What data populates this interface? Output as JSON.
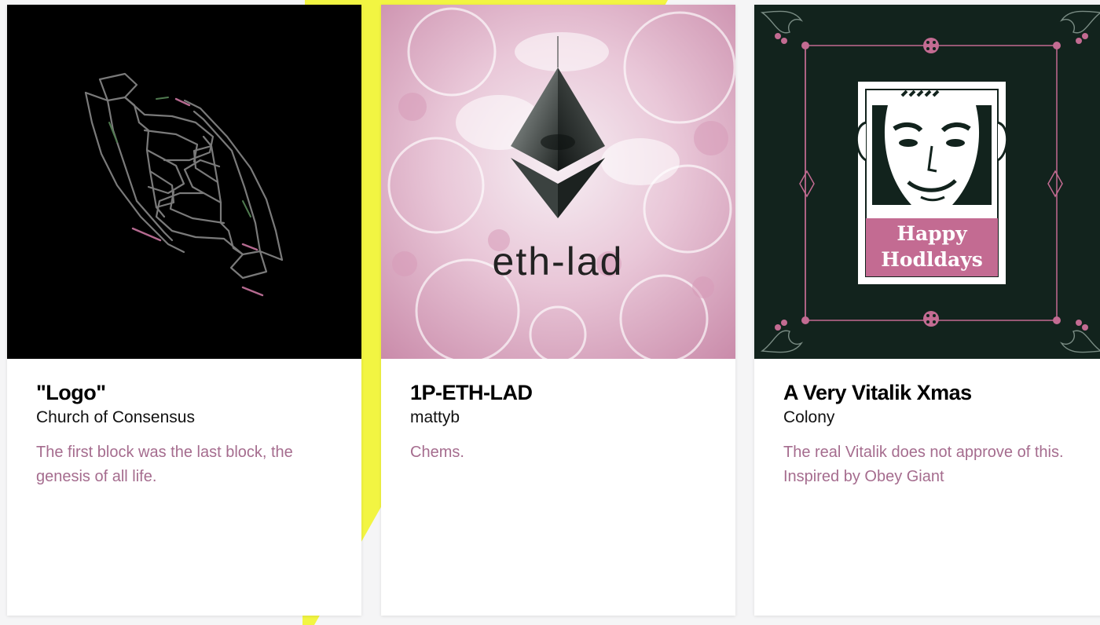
{
  "colors": {
    "accent_yellow": "#f2f542",
    "description_text": "#a56c8e",
    "xmas_bg": "#12231d",
    "xmas_pink": "#c36b92"
  },
  "cards": [
    {
      "title": "\"Logo\"",
      "artist": "Church of Consensus",
      "description": "The first block was the last block, the genesis of all life.",
      "art_icon": "clasped-hands-icon"
    },
    {
      "title": "1P-ETH-LAD",
      "artist": "mattyb",
      "description": "Chems.",
      "art_text": "eth-lad",
      "art_icon": "ethereum-diamond-icon"
    },
    {
      "title": "A Very Vitalik Xmas",
      "artist": "Colony",
      "description": "The real Vitalik does not approve of this. Inspired by Obey Giant",
      "art_text_line1": "Happy",
      "art_text_line2": "Hodldays",
      "art_icon": "vitalik-portrait-icon"
    }
  ]
}
